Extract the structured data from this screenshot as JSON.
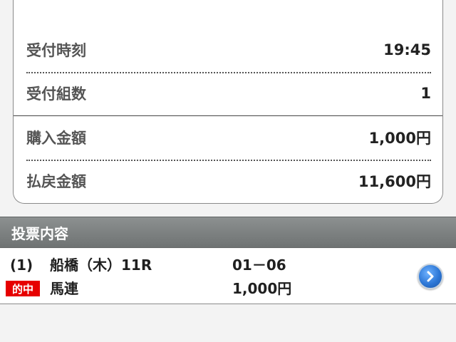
{
  "summary": {
    "rows": [
      {
        "label": "受付時刻",
        "value": "19:45"
      },
      {
        "label": "受付組数",
        "value": "1"
      },
      {
        "label": "購入金額",
        "value": "1,000円"
      },
      {
        "label": "払戻金額",
        "value": "11,600円"
      }
    ]
  },
  "bet_section": {
    "title": "投票内容",
    "entry": {
      "index": "(1)",
      "venue": "船橋（木）11R",
      "combination": "01－06",
      "hit_badge": "的中",
      "bet_type": "馬連",
      "amount": "1,000円"
    }
  },
  "icons": {
    "detail_button": "chevron-right-icon"
  },
  "colors": {
    "hit_badge": "#e60000",
    "header_bg": "#7d8181",
    "detail_button": "#2d77d6"
  }
}
